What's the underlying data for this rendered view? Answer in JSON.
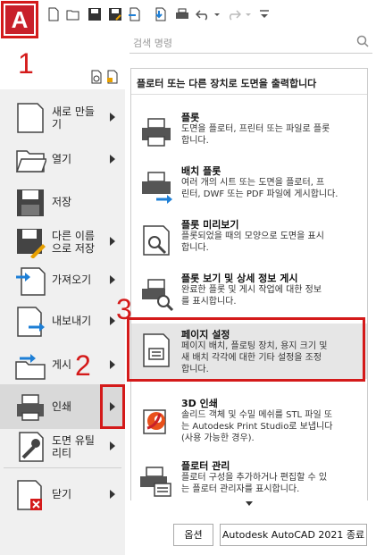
{
  "app_logo": "A",
  "annotations": {
    "n1": "1",
    "n2": "2",
    "n3": "3"
  },
  "search": {
    "placeholder": "검색 명령"
  },
  "menu": [
    {
      "label": "새로 만들\n기",
      "has_arrow": true
    },
    {
      "label": "열기",
      "has_arrow": true
    },
    {
      "label": "저장",
      "has_arrow": false
    },
    {
      "label": "다른 이름\n으로 저장",
      "has_arrow": true
    },
    {
      "label": "가져오기",
      "has_arrow": true
    },
    {
      "label": "내보내기",
      "has_arrow": true
    },
    {
      "label": "게시",
      "has_arrow": true
    },
    {
      "label": "인쇄",
      "has_arrow": true
    },
    {
      "label": "도면 유틸\n리티",
      "has_arrow": true
    },
    {
      "label": "닫기",
      "has_arrow": true
    }
  ],
  "panel": {
    "title": "플로터 또는 다른 장치로 도면을 출력합니다",
    "entries": [
      {
        "title": "플롯",
        "desc": "도면을 플로터, 프린터 또는 파일로 플롯\n합니다."
      },
      {
        "title": "배치 플롯",
        "desc": "여러 개의 시트 또는 도면을 플로터, 프\n린터, DWF 또는 PDF 파일에 게시합니다."
      },
      {
        "title": "플롯 미리보기",
        "desc": "플롯되었을 때의 모양으로 도면을 표시\n합니다."
      },
      {
        "title": "플롯 보기 및 상세 정보 게시",
        "desc": "완료한 플롯 및 게시 작업에 대한 정보\n를 표시합니다."
      },
      {
        "title": "페이지 설정",
        "desc": "페이지 배치, 플로팅 장치, 용지 크기 및\n새 배치 각각에 대한 기타 설정을 조정\n합니다."
      },
      {
        "title": "3D 인쇄",
        "desc": "솔리드 객체 및 수밀 메쉬를 STL 파일 또\n는 Autodesk Print Studio로 보냅니다\n(사용 가능한 경우)."
      },
      {
        "title": "플로터 관리",
        "desc": "플로터 구성을 추가하거나 편집할 수 있\n는 플로터 관리자를 표시합니다."
      }
    ]
  },
  "footer": {
    "options": "옵션",
    "exit": "Autodesk AutoCAD 2021 종료"
  }
}
